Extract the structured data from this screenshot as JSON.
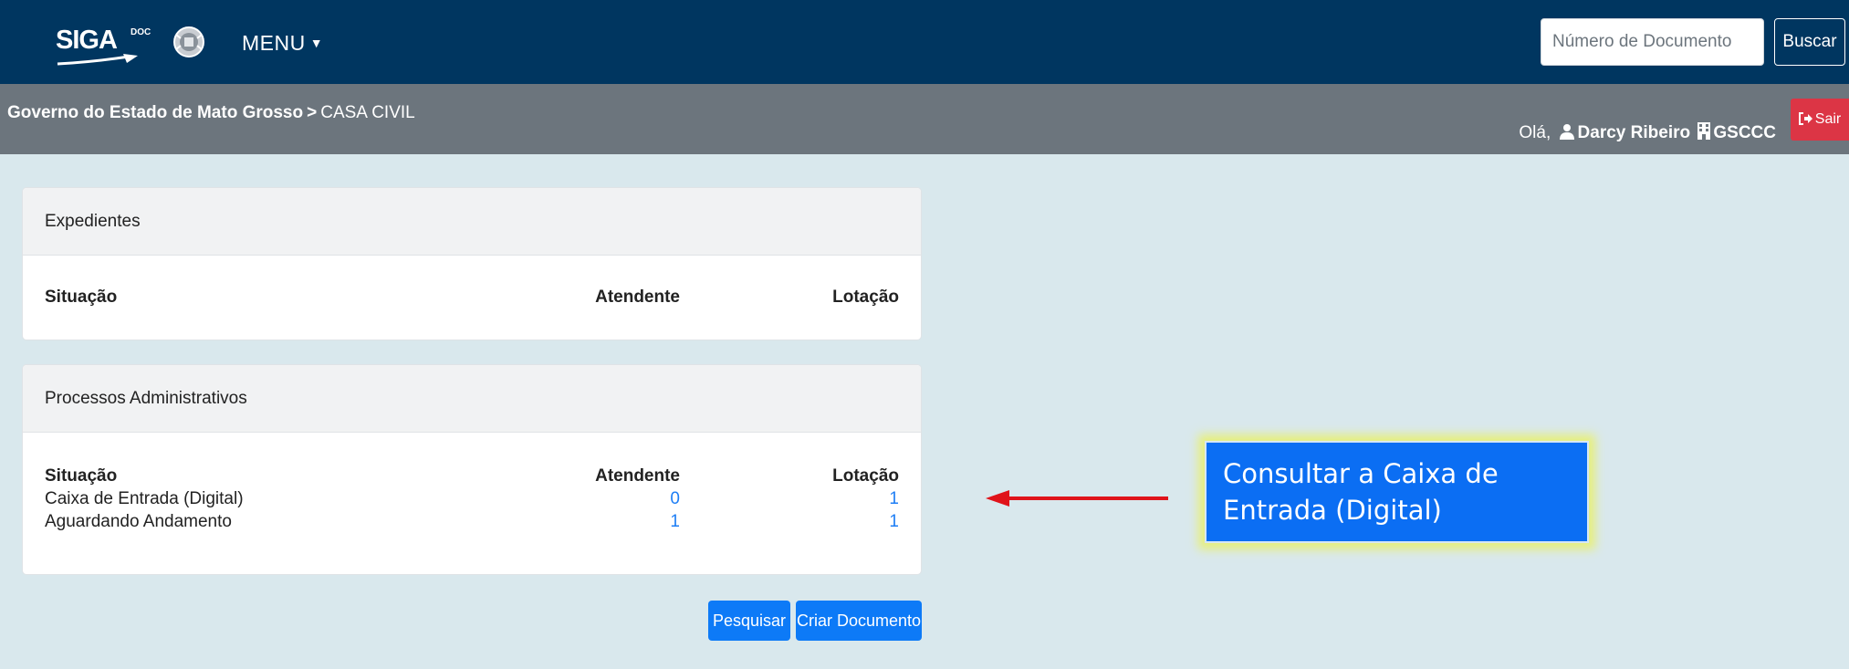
{
  "header": {
    "logo_text": "SIGA",
    "logo_sup": "DOC",
    "menu_label": "MENU",
    "search_placeholder": "Número de Documento",
    "search_button": "Buscar"
  },
  "breadcrumb": {
    "org": "Governo do Estado de Mato Grosso",
    "separator": ">",
    "unit": "CASA CIVIL"
  },
  "user": {
    "greeting": "Olá,",
    "name": "Darcy Ribeiro",
    "lotacao": "GSCCC",
    "exit_label": "Sair"
  },
  "panels": [
    {
      "title": "Expedientes",
      "columns": [
        "Situação",
        "Atendente",
        "Lotação"
      ],
      "rows": []
    },
    {
      "title": "Processos Administrativos",
      "columns": [
        "Situação",
        "Atendente",
        "Lotação"
      ],
      "rows": [
        {
          "situacao": "Caixa de Entrada (Digital)",
          "atendente": "0",
          "lotacao": "1"
        },
        {
          "situacao": "Aguardando Andamento",
          "atendente": "1",
          "lotacao": "1"
        }
      ]
    }
  ],
  "actions": {
    "search_label": "Pesquisar",
    "create_label": "Criar Documento"
  },
  "annotation": {
    "text": "Consultar a Caixa de Entrada (Digital)"
  },
  "colors": {
    "navbar": "#003660",
    "subbar": "#6c757d",
    "background": "#d9e8ed",
    "primary": "#0d7af7",
    "danger": "#dc3545",
    "arrow": "#e0131a",
    "callout_glow": "#e7ef7c"
  }
}
